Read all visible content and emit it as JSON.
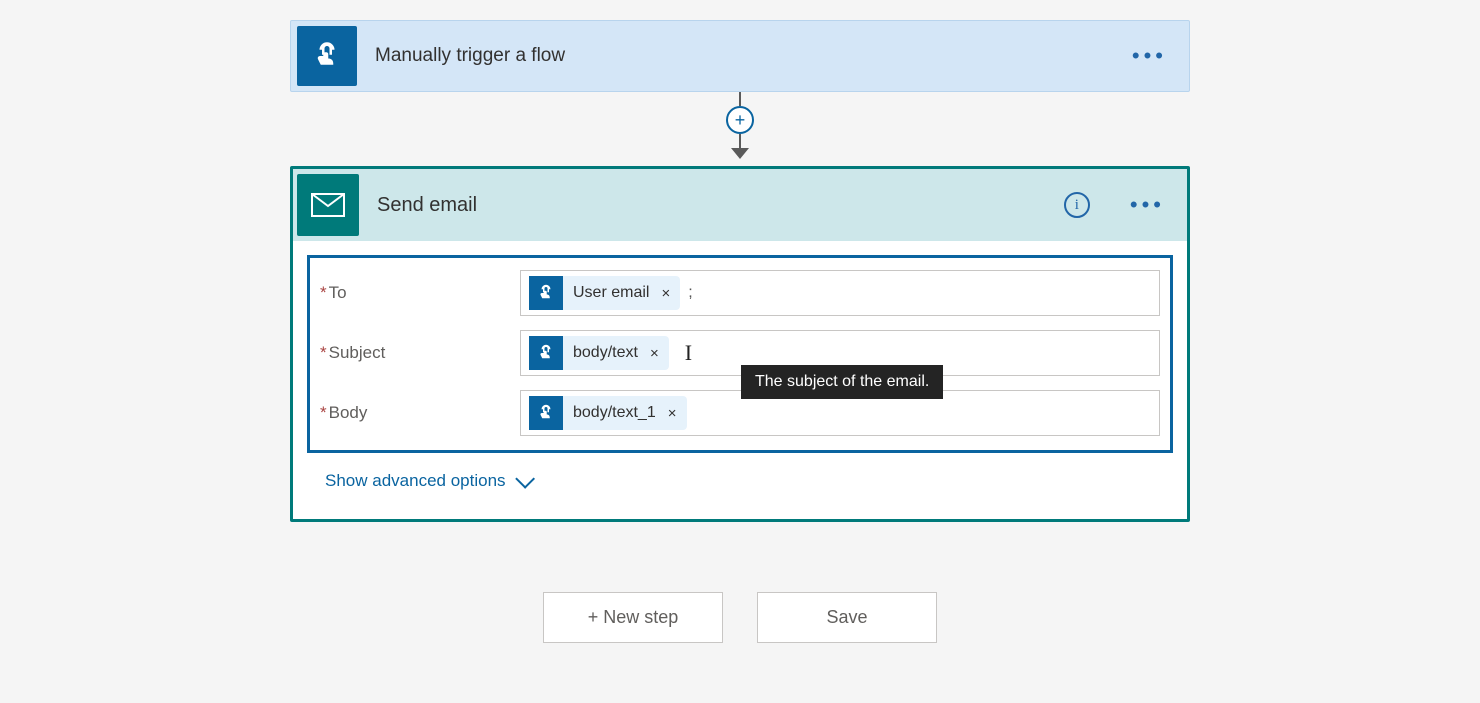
{
  "trigger": {
    "title": "Manually trigger a flow"
  },
  "action": {
    "title": "Send email",
    "fields": {
      "to": {
        "label": "To",
        "token": "User email",
        "suffix": ";"
      },
      "subject": {
        "label": "Subject",
        "token": "body/text",
        "tooltip": "The subject of the email."
      },
      "body": {
        "label": "Body",
        "token": "body/text_1"
      }
    },
    "advanced_label": "Show advanced options"
  },
  "buttons": {
    "new_step": "+ New step",
    "save": "Save"
  }
}
